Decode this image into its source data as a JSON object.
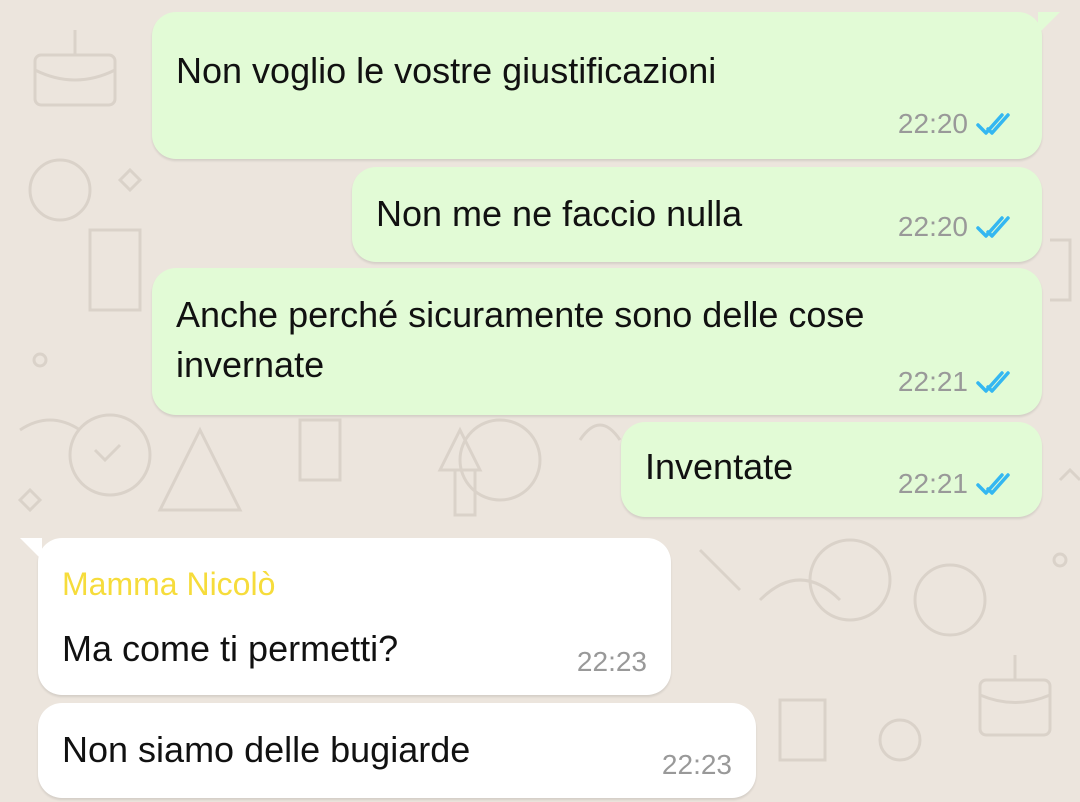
{
  "colors": {
    "background": "#ece5dd",
    "outgoing_bubble": "#e2fbd6",
    "incoming_bubble": "#ffffff",
    "read_ticks": "#34b7f1",
    "sender_name": "#f6dc3b"
  },
  "messages": [
    {
      "direction": "outgoing",
      "text": "Non voglio le vostre giustificazioni",
      "time": "22:20",
      "status": "read",
      "status_icon": "double-check-icon"
    },
    {
      "direction": "outgoing",
      "text": "Non me ne faccio nulla",
      "time": "22:20",
      "status": "read",
      "status_icon": "double-check-icon"
    },
    {
      "direction": "outgoing",
      "text": "Anche perché sicuramente sono delle cose\ninvernate",
      "time": "22:21",
      "status": "read",
      "status_icon": "double-check-icon"
    },
    {
      "direction": "outgoing",
      "text": "Inventate",
      "time": "22:21",
      "status": "read",
      "status_icon": "double-check-icon"
    },
    {
      "direction": "incoming",
      "sender": "Mamma Nicolò",
      "text": "Ma come ti permetti?",
      "time": "22:23"
    },
    {
      "direction": "incoming",
      "text": "Non siamo delle bugiarde",
      "time": "22:23"
    }
  ]
}
